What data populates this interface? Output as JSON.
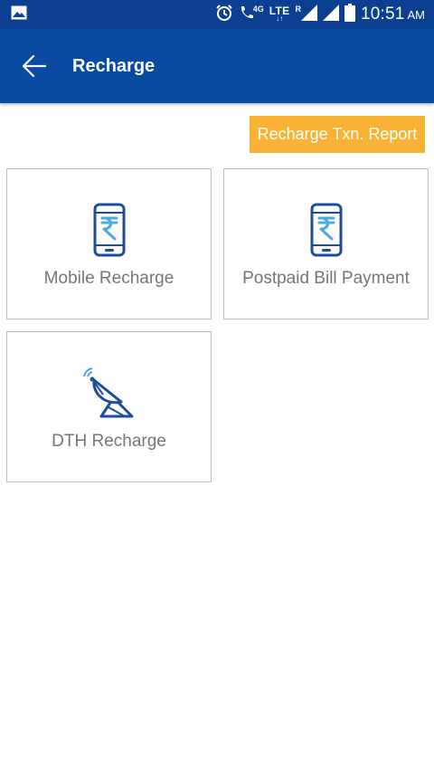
{
  "status_bar": {
    "time": "10:51",
    "ampm": "AM",
    "network_4g": "4G",
    "network_lte": "LTE",
    "network_lte_arrows": "↓↑",
    "roaming": "R",
    "icons": [
      "image-icon",
      "alarm-icon",
      "volte-call-icon",
      "signal-icon",
      "signal-icon",
      "battery-icon"
    ]
  },
  "app_bar": {
    "title": "Recharge",
    "back_icon": "arrow-left-icon"
  },
  "report_button": {
    "label": "Recharge Txn. Report"
  },
  "tiles": [
    {
      "label": "Mobile Recharge",
      "icon": "phone-rupee-icon"
    },
    {
      "label": "Postpaid Bill Payment",
      "icon": "phone-rupee-icon"
    },
    {
      "label": "DTH Recharge",
      "icon": "satellite-dish-icon"
    }
  ],
  "colors": {
    "status_bar": "#0a3f92",
    "app_bar": "#0a4aa2",
    "accent": "#f9b233",
    "icon_primary": "#1e4d9c",
    "icon_secondary": "#4fa8dc",
    "tile_text": "#757575"
  }
}
